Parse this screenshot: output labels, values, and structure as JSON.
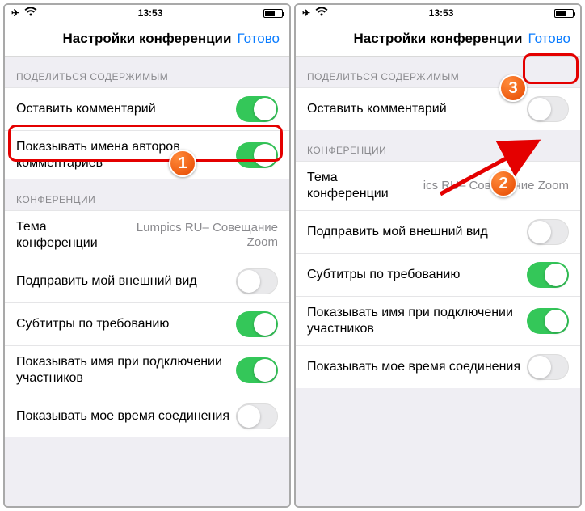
{
  "statusbar": {
    "time": "13:53"
  },
  "nav": {
    "title": "Настройки конференции",
    "done": "Готово"
  },
  "left": {
    "section_share": "ПОДЕЛИТЬСЯ СОДЕРЖИМЫМ",
    "row_comment": "Оставить комментарий",
    "row_show_author": "Показывать имена авторов комментариев",
    "section_conf": "КОНФЕРЕНЦИИ",
    "row_topic_label": "Тема конференции",
    "row_topic_value": "Lumpics RU– Совещание Zoom",
    "row_beauty": "Подправить мой внешний вид",
    "row_subtitles": "Субтитры по требованию",
    "row_name_join": "Показывать имя при подключении участников",
    "row_my_time": "Показывать мое время соединения"
  },
  "right": {
    "section_share": "ПОДЕЛИТЬСЯ СОДЕРЖИМЫМ",
    "row_comment": "Оставить комментарий",
    "section_conf": "КОНФЕРЕНЦИИ",
    "row_topic_label": "Тема конференции",
    "row_topic_value": "ics RU– Совещание Zoom",
    "row_beauty": "Подправить мой внешний вид",
    "row_subtitles": "Субтитры по требованию",
    "row_name_join": "Показывать имя при подключении участников",
    "row_my_time": "Показывать мое время соединения"
  },
  "badges": {
    "b1": "1",
    "b2": "2",
    "b3": "3"
  }
}
